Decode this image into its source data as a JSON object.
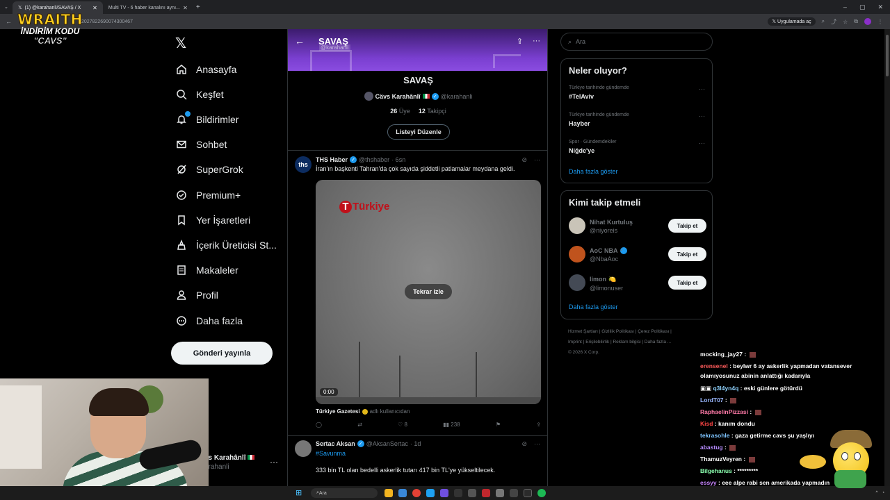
{
  "browser": {
    "tabs": [
      {
        "label": "(1) @karahanli/SAVAŞ / X",
        "active": true
      },
      {
        "label": "Multi TV - 6 haber kanalını aynı...",
        "active": false
      }
    ],
    "url": "2027822690074300467",
    "open_in_app": "Uygulamada aç"
  },
  "overlay": {
    "brand": "WRAITH",
    "promo": "İNDİRİM KODU",
    "code": "\"CAVS\""
  },
  "nav": {
    "items": [
      {
        "label": "Anasayfa",
        "icon": "home-icon"
      },
      {
        "label": "Keşfet",
        "icon": "search-icon"
      },
      {
        "label": "Bildirimler",
        "icon": "bell-icon"
      },
      {
        "label": "Sohbet",
        "icon": "mail-icon"
      },
      {
        "label": "SuperGrok",
        "icon": "grok-icon"
      },
      {
        "label": "Premium+",
        "icon": "verified-icon"
      },
      {
        "label": "Yer İşaretleri",
        "icon": "bookmark-icon"
      },
      {
        "label": "İçerik Üreticisi St...",
        "icon": "creator-icon"
      },
      {
        "label": "Makaleler",
        "icon": "article-icon"
      },
      {
        "label": "Profil",
        "icon": "profile-icon"
      },
      {
        "label": "Daha fazla",
        "icon": "more-icon"
      }
    ],
    "post_button": "Gönderi yayınla",
    "account_name": "Çavs Karahânlî",
    "account_handle": "@karahanli",
    "account_name_visible": "vs Karahânlî",
    "account_handle_visible": "arahanli"
  },
  "list": {
    "header_title": "SAVAŞ",
    "header_sub": "@karahanli",
    "name": "SAVAŞ",
    "owner_name": "Cävs Karahânlî",
    "owner_handle": "@karahanli",
    "members_count": "26",
    "members_label": "Üye",
    "followers_count": "12",
    "followers_label": "Takipçi",
    "edit_button": "Listeyi Düzenle"
  },
  "post1": {
    "author": "THS Haber",
    "handle": "@thshaber",
    "time": "· 6sn",
    "text": "İran'ın başkenti Tahran'da çok sayıda şiddetli patlamalar meydana geldi.",
    "media_logo": "Türkiye",
    "replay_label": "Tekrar izle",
    "video_time": "0:00",
    "source_name": "Türkiye Gazetesi",
    "source_suffix": "adlı kullanıcıdan",
    "likes": "8",
    "views": "238",
    "avatar_text": "ths"
  },
  "post2": {
    "author": "Sertac Aksan",
    "handle": "@AksanSertac",
    "time": "· 1d",
    "hashtag": "#Savunma",
    "text": "333 bin TL olan bedelli askerlik tutarı 417 bin TL'ye yükseltilecek."
  },
  "sidebar": {
    "search_placeholder": "Ara",
    "trends_title": "Neler oluyor?",
    "trends": [
      {
        "context": "Türkiye tarihinde gündemde",
        "name": "#TelAviv"
      },
      {
        "context": "Türkiye tarihinde gündemde",
        "name": "Hayber"
      },
      {
        "context": "Spor · Gündemdekiler",
        "name": "Niğde'ye"
      }
    ],
    "show_more": "Daha fazla göster",
    "who_title": "Kimi takip etmeli",
    "who": [
      {
        "name": "Nihat Kurtuluş",
        "handle": "@niyoreis",
        "verified": false,
        "button": "Takip et"
      },
      {
        "name": "AoC NBA",
        "handle": "@NbaAoc",
        "verified": true,
        "button": "Takip et"
      },
      {
        "name": "limon",
        "handle": "@limonuser",
        "verified": false,
        "button": "Takip et"
      }
    ],
    "footer_links": [
      "Hizmet Şartları",
      "Gizlilik Politikası",
      "Çerez Politikası",
      "Imprint",
      "Erişilebilirlik",
      "Reklam bilgisi",
      "Daha fazla ..."
    ],
    "copyright": "© 2026 X Corp."
  },
  "chat": [
    {
      "user": "mocking_jay27",
      "msg": "",
      "color": "#ffffff",
      "emote": true
    },
    {
      "user": "erensenel",
      "msg": "beylwr 6 ay askerlik yapmadan vatansever olamıyosunuz abinin anlattığı kadarıyla",
      "color": "#ff5b5b",
      "emote": false
    },
    {
      "user": "q3l4yn4q",
      "msg": "eski günlere götürdü",
      "color": "#8fd3ff",
      "emote": false
    },
    {
      "user": "LordT07",
      "msg": "",
      "color": "#9ab8ff",
      "emote": true
    },
    {
      "user": "RaphaelinPizzasi",
      "msg": "",
      "color": "#ff7aa8",
      "emote": true
    },
    {
      "user": "Kisd",
      "msg": "kanım dondu",
      "color": "#ff4545",
      "emote": false
    },
    {
      "user": "tekrasohle",
      "msg": "gaza getirme cavs şu yaşlıyı",
      "color": "#7ec4ff",
      "emote": false
    },
    {
      "user": "abastug",
      "msg": "",
      "color": "#b78cff",
      "emote": true
    },
    {
      "user": "ThamuzVeyren",
      "msg": "",
      "color": "#ffffff",
      "emote": true
    },
    {
      "user": "Bilgehanus",
      "msg": "*********",
      "color": "#8cffb0",
      "emote": false
    },
    {
      "user": "essyy",
      "msg": "eee alpe rabi sen amerikada yapmadın",
      "color": "#c986ff",
      "emote": false
    }
  ],
  "taskbar": {
    "search": "Ara"
  },
  "colors": {
    "accent": "#1d9bf0",
    "banner": "#7a3fd0",
    "bg": "#000000"
  }
}
